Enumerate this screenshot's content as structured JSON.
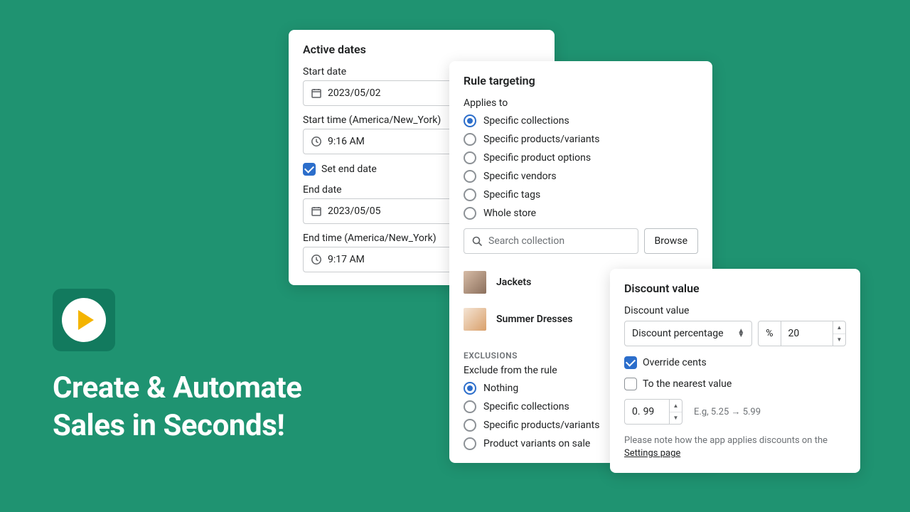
{
  "headline_line1": "Create & Automate",
  "headline_line2": "Sales in Seconds!",
  "dates": {
    "title": "Active dates",
    "start_date_label": "Start date",
    "start_date_value": "2023/05/02",
    "start_time_label": "Start time (America/New_York)",
    "start_time_value": "9:16 AM",
    "set_end_date_label": "Set end date",
    "end_date_label": "End date",
    "end_date_value": "2023/05/05",
    "end_time_label": "End time (America/New_York)",
    "end_time_value": "9:17 AM"
  },
  "target": {
    "title": "Rule targeting",
    "applies_to_label": "Applies to",
    "options": [
      "Specific collections",
      "Specific products/variants",
      "Specific product options",
      "Specific vendors",
      "Specific tags",
      "Whole store"
    ],
    "search_placeholder": "Search collection",
    "browse_label": "Browse",
    "collections": [
      "Jackets",
      "Summer Dresses"
    ],
    "exclusions_heading": "EXCLUSIONS",
    "exclude_label": "Exclude from the rule",
    "exclude_options": [
      "Nothing",
      "Specific collections",
      "Specific products/variants",
      "Product variants on sale"
    ]
  },
  "discount": {
    "title": "Discount value",
    "value_label": "Discount value",
    "type_value": "Discount percentage",
    "pct_prefix": "%",
    "pct_value": "20",
    "override_cents_label": "Override cents",
    "to_nearest_label": "To the nearest value",
    "nv_prefix": "0.",
    "nv_value": "99",
    "example_text": "E.g, 5.25 → 5.99",
    "note_text": "Please note how the app applies discounts on the ",
    "note_link": "Settings page"
  }
}
